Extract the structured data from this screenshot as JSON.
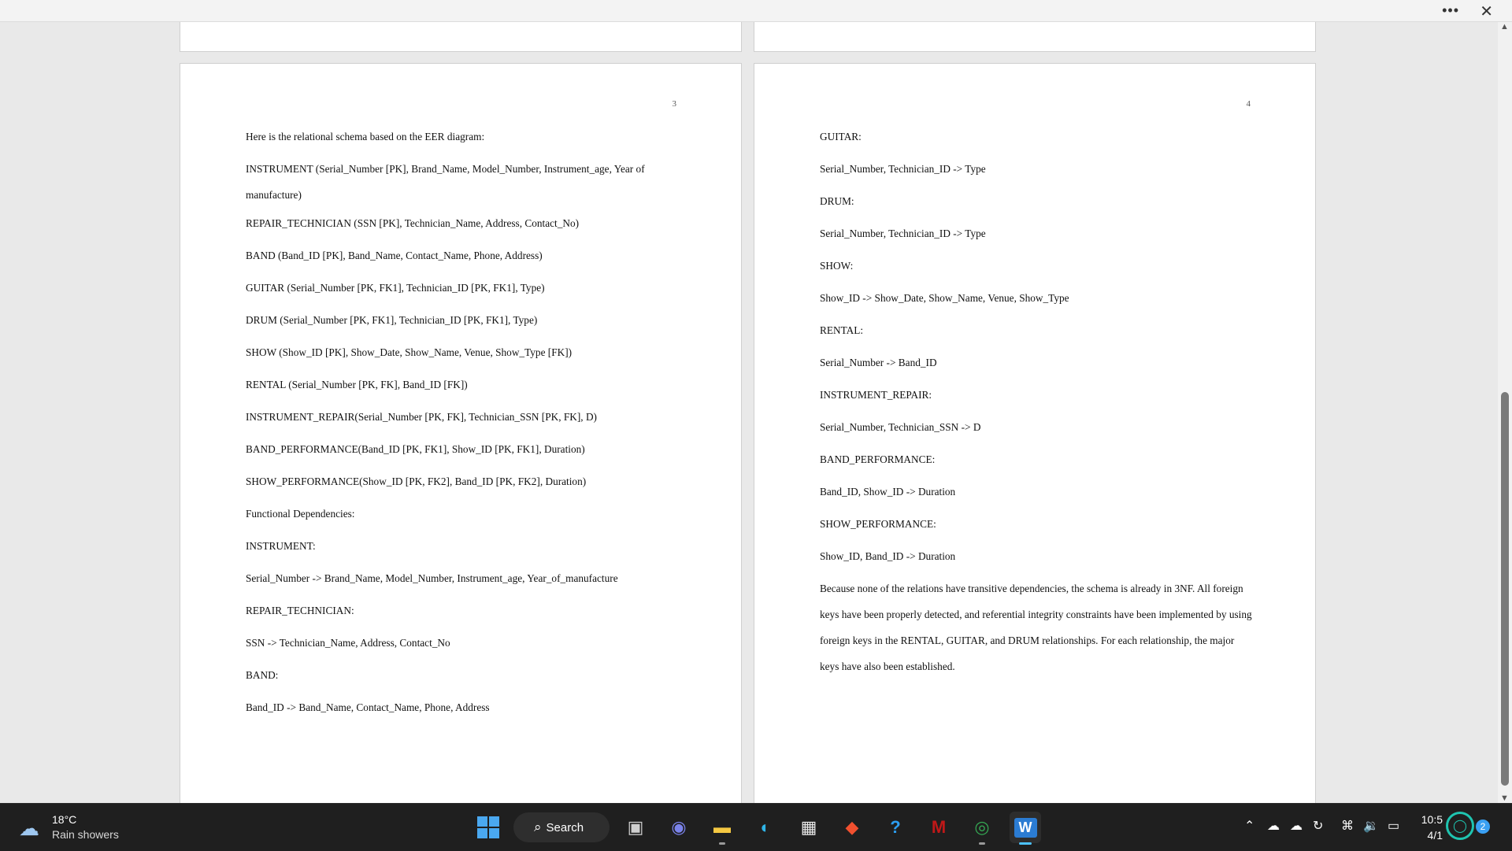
{
  "window": {
    "more_icon": "more-horizontal-icon",
    "more_glyph": "•••",
    "close_glyph": "✕"
  },
  "document": {
    "pages": [
      {
        "number": "3",
        "paragraphs": [
          "Here is the relational schema based on the EER diagram:",
          "INSTRUMENT (Serial_Number [PK], Brand_Name, Model_Number, Instrument_age, Year of manufacture)",
          "REPAIR_TECHNICIAN (SSN [PK], Technician_Name, Address, Contact_No)",
          "BAND (Band_ID [PK], Band_Name, Contact_Name, Phone, Address)",
          "GUITAR (Serial_Number [PK, FK1], Technician_ID [PK, FK1], Type)",
          "DRUM (Serial_Number [PK, FK1], Technician_ID [PK, FK1], Type)",
          "SHOW (Show_ID [PK], Show_Date, Show_Name, Venue, Show_Type [FK])",
          "RENTAL (Serial_Number [PK, FK], Band_ID [FK])",
          "INSTRUMENT_REPAIR(Serial_Number [PK, FK], Technician_SSN [PK, FK], D)",
          "BAND_PERFORMANCE(Band_ID [PK, FK1], Show_ID [PK, FK1], Duration)",
          "SHOW_PERFORMANCE(Show_ID [PK, FK2], Band_ID [PK, FK2], Duration)",
          "Functional Dependencies:",
          "INSTRUMENT:",
          "Serial_Number -> Brand_Name, Model_Number, Instrument_age, Year_of_manufacture",
          "REPAIR_TECHNICIAN:",
          "SSN -> Technician_Name, Address, Contact_No",
          "BAND:",
          "Band_ID -> Band_Name, Contact_Name, Phone, Address"
        ]
      },
      {
        "number": "4",
        "paragraphs": [
          "GUITAR:",
          "Serial_Number, Technician_ID -> Type",
          "DRUM:",
          "Serial_Number, Technician_ID -> Type",
          "SHOW:",
          "Show_ID -> Show_Date, Show_Name, Venue, Show_Type",
          "RENTAL:",
          "Serial_Number -> Band_ID",
          "INSTRUMENT_REPAIR:",
          "Serial_Number, Technician_SSN -> D",
          "BAND_PERFORMANCE:",
          "Band_ID, Show_ID -> Duration",
          "SHOW_PERFORMANCE:",
          "Show_ID, Band_ID -> Duration",
          "Because none of the relations have transitive dependencies, the schema is already in 3NF. All foreign keys have been properly detected, and referential integrity constraints have been implemented by using foreign keys in the RENTAL, GUITAR, and DRUM relationships. For each relationship, the major keys have also been established."
        ]
      }
    ]
  },
  "scrollbar": {
    "up_glyph": "▲",
    "down_glyph": "▼"
  },
  "taskbar": {
    "weather": {
      "temperature": "18°C",
      "condition": "Rain showers",
      "icon": "rain-cloud-icon"
    },
    "search_label": "Search",
    "search_glyph": "⌕",
    "apps": [
      {
        "name": "start-icon"
      },
      {
        "name": "task-view-icon",
        "glyph": "▣",
        "color": "#cfcfcf"
      },
      {
        "name": "teams-meet-icon",
        "glyph": "◉",
        "color": "#7b83eb"
      },
      {
        "name": "file-explorer-icon",
        "glyph": "▬",
        "color": "#f5c842"
      },
      {
        "name": "edge-icon",
        "glyph": "◐",
        "color": "#2fb5e8"
      },
      {
        "name": "microsoft-store-icon",
        "glyph": "▦",
        "color": "#e8e8e8"
      },
      {
        "name": "git-icon",
        "glyph": "◆",
        "color": "#f1502f"
      },
      {
        "name": "help-icon",
        "glyph": "?",
        "color": "#2c9df0"
      },
      {
        "name": "mcafee-icon",
        "glyph": "M",
        "color": "#c01818"
      },
      {
        "name": "chrome-icon",
        "glyph": "◎",
        "color": "#35a853"
      },
      {
        "name": "word-icon",
        "glyph": "W",
        "color": "#2b7cd3"
      }
    ],
    "clock": {
      "time": "10:5",
      "date": "4/1"
    },
    "notification_count": "2"
  }
}
